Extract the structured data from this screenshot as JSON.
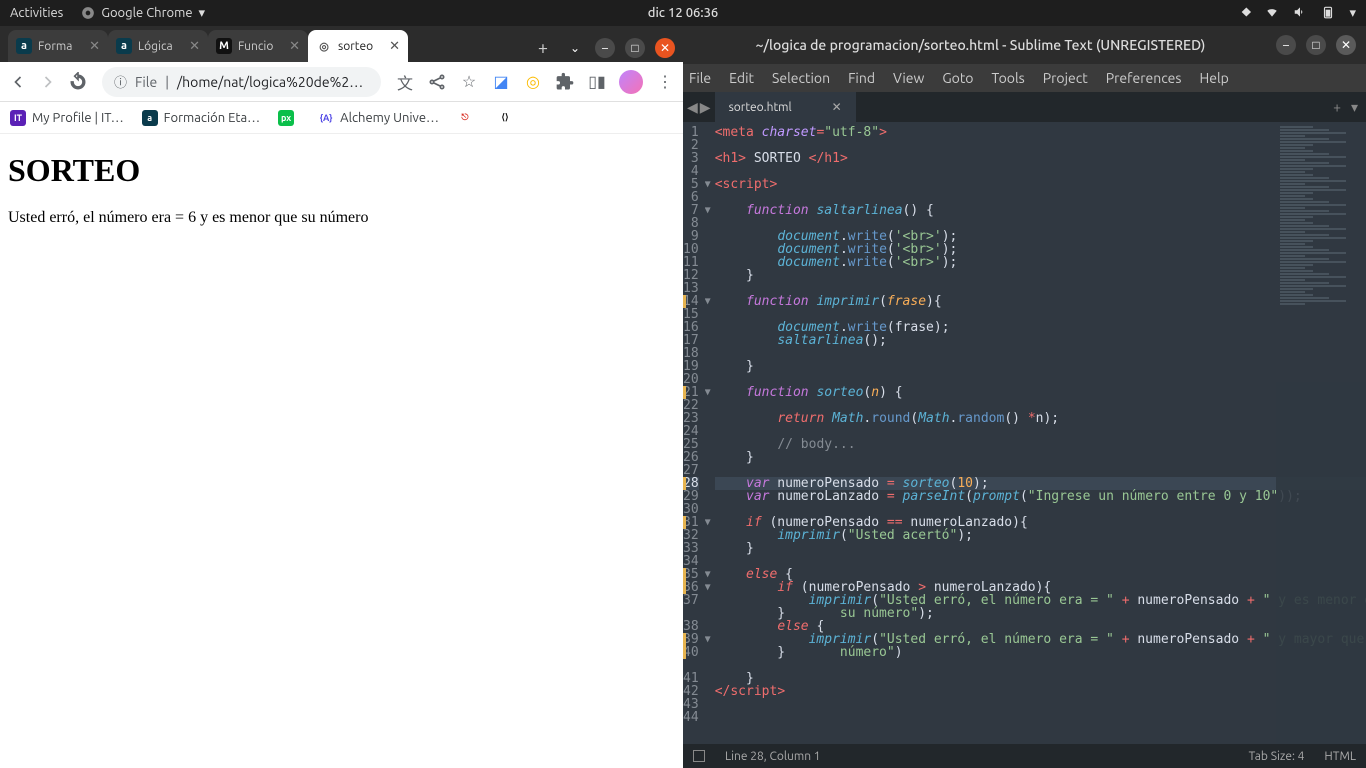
{
  "topbar": {
    "activities": "Activities",
    "app_name": "Google Chrome",
    "clock": "dic 12  06:36"
  },
  "chrome": {
    "tabs": [
      {
        "title": "Forma",
        "favicon_bg": "#0a3b4c",
        "favicon_fg": "#fff",
        "favicon_text": "a"
      },
      {
        "title": "Lógica",
        "favicon_bg": "#0a3b4c",
        "favicon_fg": "#fff",
        "favicon_text": "a"
      },
      {
        "title": "Funcio",
        "favicon_bg": "#111",
        "favicon_fg": "#fff",
        "favicon_text": "M"
      },
      {
        "title": "sorteo",
        "active": true,
        "favicon_bg": "#fff",
        "favicon_fg": "#555",
        "favicon_text": "◎"
      }
    ],
    "url_prefix": "File",
    "url_path": "/home/nat/logica%20de%2…",
    "bookmarks": [
      {
        "label": "My Profile | IT…",
        "icon_bg": "#5b21b6",
        "icon_fg": "#fff",
        "icon_text": "IT"
      },
      {
        "label": "Formación Eta…",
        "icon_bg": "#0a3b4c",
        "icon_fg": "#fff",
        "icon_text": "a"
      },
      {
        "label": "",
        "icon_bg": "#0bbf4a",
        "icon_fg": "#fff",
        "icon_text": "px"
      },
      {
        "label": "Alchemy Unive…",
        "icon_bg": "#fff",
        "icon_fg": "#4f46e5",
        "icon_text": "{A}"
      },
      {
        "label": "",
        "icon_bg": "#fff",
        "icon_fg": "#d93025",
        "icon_text": "⎋"
      },
      {
        "label": "",
        "icon_bg": "#fff",
        "icon_fg": "#111",
        "icon_text": "⟨⟩"
      }
    ]
  },
  "page": {
    "heading": "SORTEO",
    "body": "Usted erró, el número era = 6 y es menor que su número"
  },
  "sublime": {
    "title": "~/logica de programacion/sorteo.html - Sublime Text (UNREGISTERED)",
    "menu": [
      "File",
      "Edit",
      "Selection",
      "Find",
      "View",
      "Goto",
      "Tools",
      "Project",
      "Preferences",
      "Help"
    ],
    "tab": "sorteo.html",
    "status_left": "Line 28, Column 1",
    "status_tabsize": "Tab Size: 4",
    "status_syntax": "HTML",
    "current_line": 28,
    "fold_markers": {
      "5": "▼",
      "7": "▼",
      "14": "▼",
      "21": "▼",
      "31": "▼",
      "35": "▼",
      "36": "▼",
      "39": "▼"
    },
    "modified_lines": [
      14,
      21,
      28,
      31,
      35,
      36,
      39,
      40
    ],
    "code": [
      {
        "n": 1,
        "html": "<span class='tok-op'>&lt;</span><span class='tok-tag'>meta</span> <span class='tok-attr'>charset</span><span class='tok-op'>=</span><span class='tok-str'>\"utf-8\"</span><span class='tok-op'>&gt;</span>"
      },
      {
        "n": 2,
        "html": ""
      },
      {
        "n": 3,
        "html": "<span class='tok-op'>&lt;</span><span class='tok-tag'>h1</span><span class='tok-op'>&gt;</span> SORTEO <span class='tok-op'>&lt;/</span><span class='tok-tag'>h1</span><span class='tok-op'>&gt;</span>"
      },
      {
        "n": 4,
        "html": ""
      },
      {
        "n": 5,
        "html": "<span class='tok-op'>&lt;</span><span class='tok-tag'>script</span><span class='tok-op'>&gt;</span>"
      },
      {
        "n": 6,
        "html": ""
      },
      {
        "n": 7,
        "html": "    <span class='tok-kw'>function</span> <span class='tok-fn'>saltarlinea</span>() {"
      },
      {
        "n": 8,
        "html": ""
      },
      {
        "n": 9,
        "html": "        <span class='tok-obj'>document</span>.<span class='tok-fn2'>write</span>(<span class='tok-str'>'&lt;br&gt;'</span>);"
      },
      {
        "n": 10,
        "html": "        <span class='tok-obj'>document</span>.<span class='tok-fn2'>write</span>(<span class='tok-str'>'&lt;br&gt;'</span>);"
      },
      {
        "n": 11,
        "html": "        <span class='tok-obj'>document</span>.<span class='tok-fn2'>write</span>(<span class='tok-str'>'&lt;br&gt;'</span>);"
      },
      {
        "n": 12,
        "html": "    }"
      },
      {
        "n": 13,
        "html": ""
      },
      {
        "n": 14,
        "html": "    <span class='tok-kw'>function</span> <span class='tok-fn'>imprimir</span>(<span class='tok-param'>frase</span>){"
      },
      {
        "n": 15,
        "html": ""
      },
      {
        "n": 16,
        "html": "        <span class='tok-obj'>document</span>.<span class='tok-fn2'>write</span>(frase);"
      },
      {
        "n": 17,
        "html": "        <span class='tok-fn'>saltarlinea</span>();"
      },
      {
        "n": 18,
        "html": ""
      },
      {
        "n": 19,
        "html": "    }"
      },
      {
        "n": 20,
        "html": ""
      },
      {
        "n": 21,
        "html": "    <span class='tok-kw'>function</span> <span class='tok-fn'>sorteo</span>(<span class='tok-param'>n</span>) {"
      },
      {
        "n": 22,
        "html": ""
      },
      {
        "n": 23,
        "html": "        <span class='tok-kw2'>return</span> <span class='tok-obj'>Math</span>.<span class='tok-fn2'>round</span>(<span class='tok-obj'>Math</span>.<span class='tok-fn2'>random</span>() <span class='tok-op'>*</span>n);"
      },
      {
        "n": 24,
        "html": ""
      },
      {
        "n": 25,
        "html": "        <span class='tok-cmt'>// body...</span>"
      },
      {
        "n": 26,
        "html": "    }"
      },
      {
        "n": 27,
        "html": ""
      },
      {
        "n": 28,
        "html": "    <span class='tok-kw'>var</span> numeroPensado <span class='tok-op'>=</span> <span class='tok-fn'>sorteo</span>(<span class='tok-num'>10</span>);"
      },
      {
        "n": 29,
        "html": "    <span class='tok-kw'>var</span> numeroLanzado <span class='tok-op'>=</span> <span class='tok-fn'>parseInt</span>(<span class='tok-fn'>prompt</span>(<span class='tok-str'>\"Ingrese un número entre 0 y 10\"</span>));"
      },
      {
        "n": 30,
        "html": ""
      },
      {
        "n": 31,
        "html": "    <span class='tok-kw2'>if</span> (numeroPensado <span class='tok-op'>==</span> numeroLanzado){"
      },
      {
        "n": 32,
        "html": "        <span class='tok-fn'>imprimir</span>(<span class='tok-str'>\"Usted acertó\"</span>);"
      },
      {
        "n": 33,
        "html": "    }"
      },
      {
        "n": 34,
        "html": ""
      },
      {
        "n": 35,
        "html": "    <span class='tok-kw2'>else</span> {"
      },
      {
        "n": 36,
        "html": "        <span class='tok-kw2'>if</span> (numeroPensado <span class='tok-op'>&gt;</span> numeroLanzado){"
      },
      {
        "n": 37,
        "html": "            <span class='tok-fn'>imprimir</span>(<span class='tok-str'>\"Usted erró, el número era = \"</span> <span class='tok-op'>+</span> numeroPensado <span class='tok-op'>+</span> <span class='tok-str'>\" y es menor que<br>                su número\"</span>);"
      },
      {
        "n": 38,
        "html": "        }"
      },
      {
        "n": 39,
        "html": "        <span class='tok-kw2'>else</span> {"
      },
      {
        "n": 40,
        "html": "            <span class='tok-fn'>imprimir</span>(<span class='tok-str'>\"Usted erró, el número era = \"</span> <span class='tok-op'>+</span> numeroPensado <span class='tok-op'>+</span> <span class='tok-str'>\" y mayor que su<br>                número\"</span>)"
      },
      {
        "n": 41,
        "html": "        }"
      },
      {
        "n": 42,
        "html": ""
      },
      {
        "n": 43,
        "html": "    }"
      },
      {
        "n": 44,
        "html": "<span class='tok-op'>&lt;/</span><span class='tok-tag'>script</span><span class='tok-op'>&gt;</span>"
      }
    ]
  }
}
